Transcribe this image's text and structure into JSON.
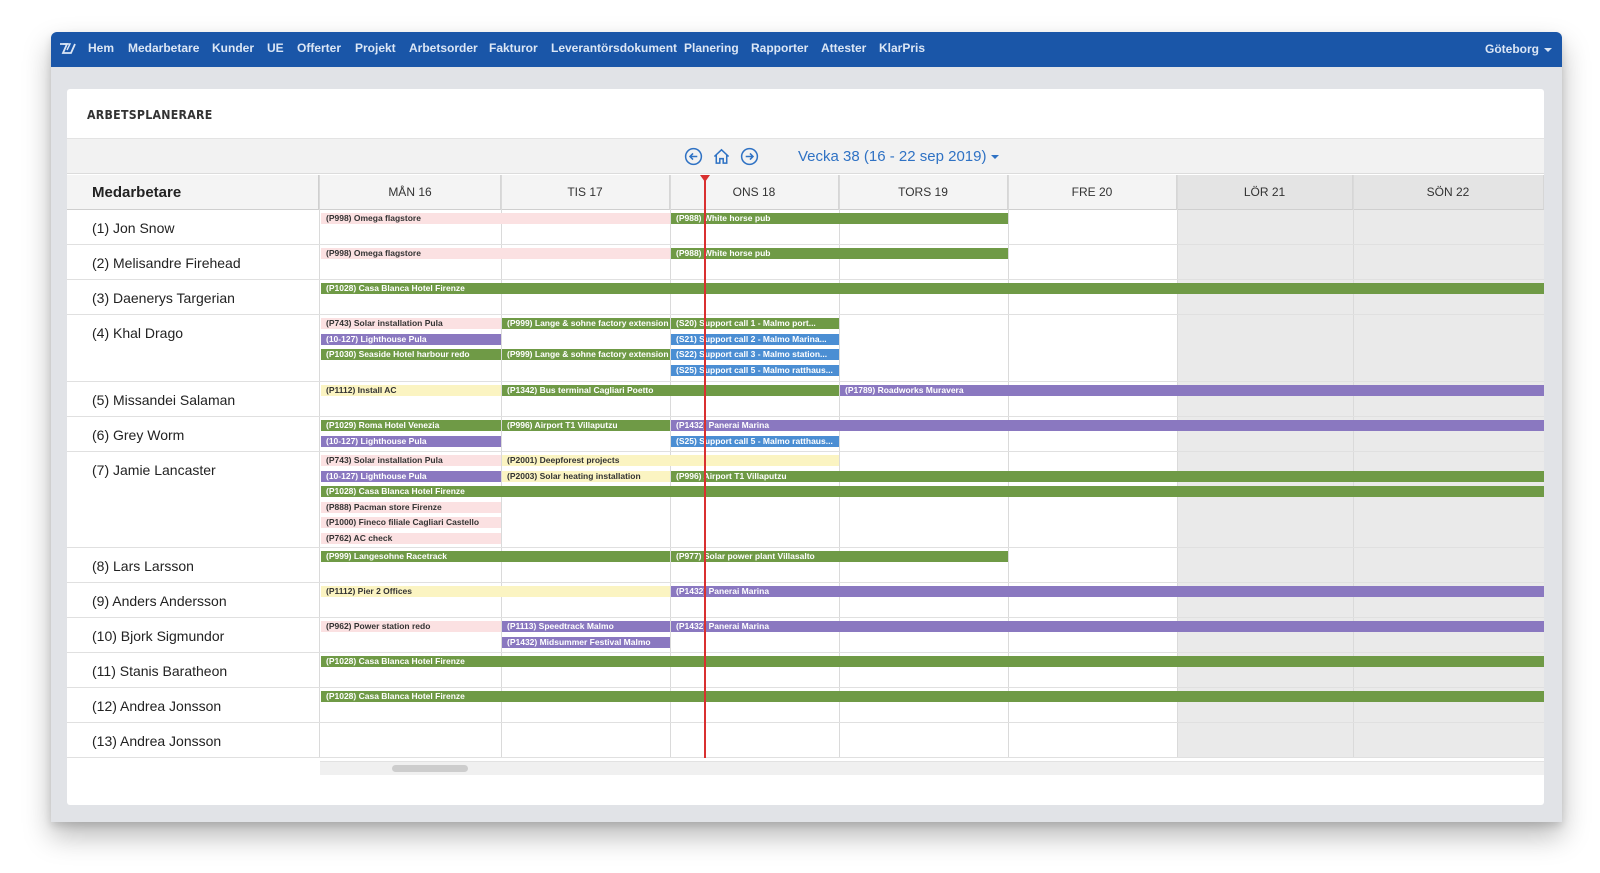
{
  "nav": {
    "items": [
      "Hem",
      "Medarbetare",
      "Kunder",
      "UE",
      "Offerter",
      "Projekt",
      "Arbetsorder",
      "Fakturor",
      "Leverantörsdokument",
      "Planering",
      "Rapporter",
      "Attester",
      "KlarPris"
    ],
    "location": "Göteborg",
    "logo_icon": "logo-icon"
  },
  "page": {
    "title": "ARBETSPLANERARE"
  },
  "week_nav": {
    "label": "Vecka 38 (16 - 22 sep 2019)",
    "icons": [
      "arrow-left-circle-icon",
      "home-icon",
      "arrow-right-circle-icon"
    ]
  },
  "schedule": {
    "employee_header": "Medarbetare",
    "days": [
      "MÅN 16",
      "TIS 17",
      "ONS 18",
      "TORS 19",
      "FRE 20",
      "LÖR 21",
      "SÖN 22"
    ],
    "weekend_days": [
      "LÖR 21",
      "SÖN 22"
    ],
    "current_time": "ONS 18",
    "colors": {
      "green": "#6f9a46",
      "purple": "#8a78c0",
      "blue": "#4b8ed3",
      "pink": "#fbe1e2",
      "yellow": "#fbf4c2",
      "now": "#d93030"
    },
    "employees": [
      {
        "name": "(1) Jon Snow",
        "events": [
          {
            "label": "(P998) Omega flagstore",
            "color": "pink",
            "start": 0,
            "end": 2,
            "lane": 0
          },
          {
            "label": "(P988) White horse pub",
            "color": "green",
            "start": 2,
            "end": 4,
            "lane": 0
          }
        ]
      },
      {
        "name": "(2) Melisandre Firehead",
        "events": [
          {
            "label": "(P998) Omega flagstore",
            "color": "pink",
            "start": 0,
            "end": 2,
            "lane": 0
          },
          {
            "label": "(P988) White horse pub",
            "color": "green",
            "start": 2,
            "end": 4,
            "lane": 0
          }
        ]
      },
      {
        "name": "(3) Daenerys Targerian",
        "events": [
          {
            "label": "(P1028) Casa Blanca Hotel Firenze",
            "color": "green",
            "start": 0,
            "end": 7,
            "lane": 0
          }
        ]
      },
      {
        "name": "(4) Khal Drago",
        "events": [
          {
            "label": "(P743) Solar installation Pula",
            "color": "pink",
            "start": 0,
            "end": 1,
            "lane": 0
          },
          {
            "label": "(P999) Lange & sohne factory extension",
            "color": "green",
            "start": 1,
            "end": 2,
            "lane": 0
          },
          {
            "label": "(S20) Support call 1 - Malmo port...",
            "color": "green",
            "start": 2,
            "end": 3,
            "lane": 0
          },
          {
            "label": "(10-127) Lighthouse Pula",
            "color": "purple",
            "start": 0,
            "end": 1,
            "lane": 1
          },
          {
            "label": "(S21) Support call 2 - Malmo Marina...",
            "color": "blue",
            "start": 2,
            "end": 3,
            "lane": 1
          },
          {
            "label": "(P1030) Seaside Hotel harbour redo",
            "color": "green",
            "start": 0,
            "end": 1,
            "lane": 2
          },
          {
            "label": "(P999) Lange & sohne factory extension",
            "color": "green",
            "start": 1,
            "end": 2,
            "lane": 2
          },
          {
            "label": "(S22) Support call 3 - Malmo station...",
            "color": "blue",
            "start": 2,
            "end": 3,
            "lane": 2
          },
          {
            "label": "(S25) Support call 5 - Malmo ratthaus...",
            "color": "blue",
            "start": 2,
            "end": 3,
            "lane": 3
          }
        ]
      },
      {
        "name": "(5) Missandei Salaman",
        "events": [
          {
            "label": "(P1112) Install AC",
            "color": "yellow",
            "start": 0,
            "end": 1,
            "lane": 0
          },
          {
            "label": "(P1342) Bus terminal Cagliari Poetto",
            "color": "green",
            "start": 1,
            "end": 3,
            "lane": 0
          },
          {
            "label": "(P1789) Roadworks Muravera",
            "color": "purple",
            "start": 3,
            "end": 7,
            "lane": 0
          }
        ]
      },
      {
        "name": "(6) Grey Worm",
        "events": [
          {
            "label": "(P1029) Roma Hotel Venezia",
            "color": "green",
            "start": 0,
            "end": 1,
            "lane": 0
          },
          {
            "label": "(P996) Airport T1 Villaputzu",
            "color": "green",
            "start": 1,
            "end": 2,
            "lane": 0
          },
          {
            "label": "(P1432) Panerai Marina",
            "color": "purple",
            "start": 2,
            "end": 7,
            "lane": 0
          },
          {
            "label": "(10-127) Lighthouse Pula",
            "color": "purple",
            "start": 0,
            "end": 1,
            "lane": 1
          },
          {
            "label": "(S25) Support call 5 - Malmo ratthaus...",
            "color": "blue",
            "start": 2,
            "end": 3,
            "lane": 1
          }
        ]
      },
      {
        "name": "(7) Jamie Lancaster",
        "events": [
          {
            "label": "(P743) Solar installation Pula",
            "color": "pink",
            "start": 0,
            "end": 1,
            "lane": 0
          },
          {
            "label": "(P2001) Deepforest projects",
            "color": "yellow",
            "start": 1,
            "end": 3,
            "lane": 0
          },
          {
            "label": "(10-127) Lighthouse Pula",
            "color": "purple",
            "start": 0,
            "end": 1,
            "lane": 1
          },
          {
            "label": "(P2003) Solar heating installation",
            "color": "yellow",
            "start": 1,
            "end": 2,
            "lane": 1
          },
          {
            "label": "(P996) Airport T1 Villaputzu",
            "color": "green",
            "start": 2,
            "end": 7,
            "lane": 1
          },
          {
            "label": "(P1028) Casa Blanca Hotel Firenze",
            "color": "green",
            "start": 0,
            "end": 7,
            "lane": 2
          },
          {
            "label": "(P888) Pacman store Firenze",
            "color": "pink",
            "start": 0,
            "end": 1,
            "lane": 3
          },
          {
            "label": "(P1000) Fineco filiale Cagliari Castello",
            "color": "pink",
            "start": 0,
            "end": 1,
            "lane": 4
          },
          {
            "label": "(P762) AC check",
            "color": "pink",
            "start": 0,
            "end": 1,
            "lane": 5
          }
        ]
      },
      {
        "name": "(8) Lars Larsson",
        "events": [
          {
            "label": "(P999) Langesohne Racetrack",
            "color": "green",
            "start": 0,
            "end": 2,
            "lane": 0
          },
          {
            "label": "(P977) Solar power plant Villasalto",
            "color": "green",
            "start": 2,
            "end": 4,
            "lane": 0
          }
        ]
      },
      {
        "name": "(9) Anders Andersson",
        "events": [
          {
            "label": "(P1112) Pier 2 Offices",
            "color": "yellow",
            "start": 0,
            "end": 2,
            "lane": 0
          },
          {
            "label": "(P1432) Panerai Marina",
            "color": "purple",
            "start": 2,
            "end": 7,
            "lane": 0
          }
        ]
      },
      {
        "name": "(10) Bjork Sigmundor",
        "events": [
          {
            "label": "(P962) Power station redo",
            "color": "pink",
            "start": 0,
            "end": 1,
            "lane": 0
          },
          {
            "label": "(P1113) Speedtrack Malmo",
            "color": "purple",
            "start": 1,
            "end": 2,
            "lane": 0
          },
          {
            "label": "(P1432) Panerai Marina",
            "color": "purple",
            "start": 2,
            "end": 7,
            "lane": 0
          },
          {
            "label": "(P1432) Midsummer Festival Malmo",
            "color": "purple",
            "start": 1,
            "end": 2,
            "lane": 1
          }
        ]
      },
      {
        "name": "(11) Stanis Baratheon",
        "events": [
          {
            "label": "(P1028) Casa Blanca Hotel Firenze",
            "color": "green",
            "start": 0,
            "end": 7,
            "lane": 0
          }
        ]
      },
      {
        "name": "(12) Andrea Jonsson",
        "events": [
          {
            "label": "(P1028) Casa Blanca Hotel Firenze",
            "color": "green",
            "start": 0,
            "end": 7,
            "lane": 0
          }
        ]
      },
      {
        "name": "(13) Andrea Jonsson",
        "events": []
      }
    ]
  }
}
